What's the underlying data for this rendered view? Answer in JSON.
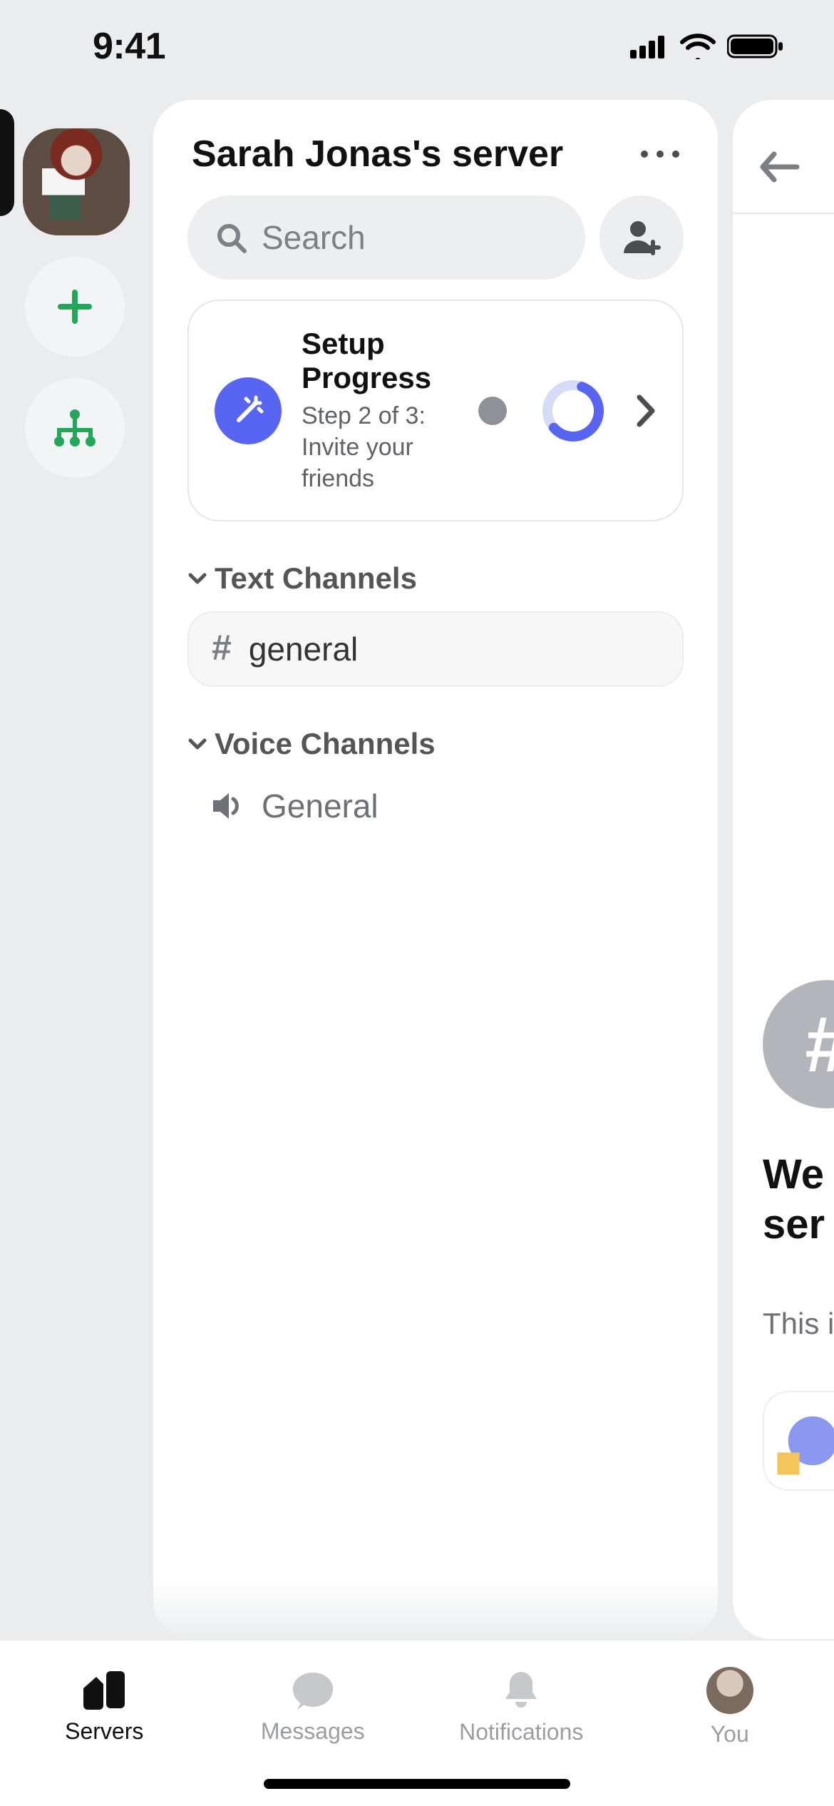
{
  "status": {
    "time": "9:41"
  },
  "server": {
    "name": "Sarah Jonas's server"
  },
  "search": {
    "placeholder": "Search"
  },
  "setup": {
    "title": "Setup Progress",
    "step_label": "Step 2 of 3: Invite your friends",
    "current_step": 2,
    "total_steps": 3
  },
  "sections": {
    "text": {
      "label": "Text Channels"
    },
    "voice": {
      "label": "Voice Channels"
    }
  },
  "channels": {
    "text": [
      {
        "name": "general"
      }
    ],
    "voice": [
      {
        "name": "General"
      }
    ]
  },
  "channel_view": {
    "welcome_line1": "We",
    "welcome_line2": "ser",
    "sub": "This i"
  },
  "tabs": {
    "servers": "Servers",
    "messages": "Messages",
    "notifications": "Notifications",
    "you": "You"
  },
  "colors": {
    "accent": "#5865f2",
    "success_green": "#23a55a"
  }
}
